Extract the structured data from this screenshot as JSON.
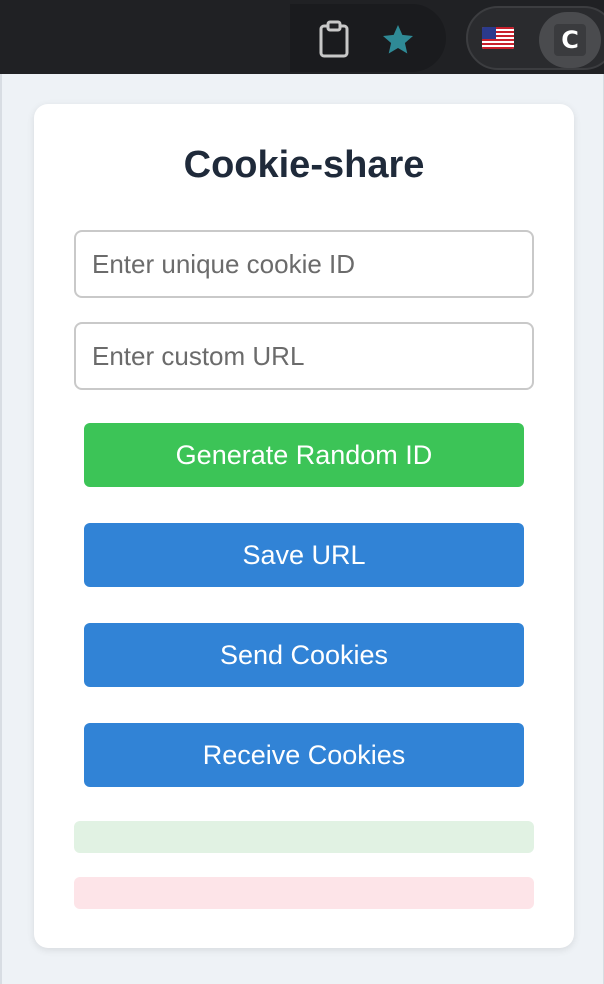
{
  "browser": {
    "toolbar_icons": [
      "clipboard-icon",
      "star-icon",
      "us-flag-icon"
    ],
    "extension_letter": "C",
    "star_color": "#2f8a96"
  },
  "popup": {
    "title": "Cookie-share",
    "inputs": {
      "cookie_id_placeholder": "Enter unique cookie ID",
      "custom_url_placeholder": "Enter custom URL"
    },
    "buttons": {
      "generate": "Generate Random ID",
      "save_url": "Save URL",
      "send": "Send Cookies",
      "receive": "Receive Cookies"
    },
    "status": {
      "success_message": "",
      "error_message": ""
    }
  },
  "colors": {
    "green_button": "#3cc457",
    "blue_button": "#3183d6",
    "success_bg": "#e1f2e3",
    "error_bg": "#fde4e8",
    "title_color": "#1f2a3a"
  }
}
